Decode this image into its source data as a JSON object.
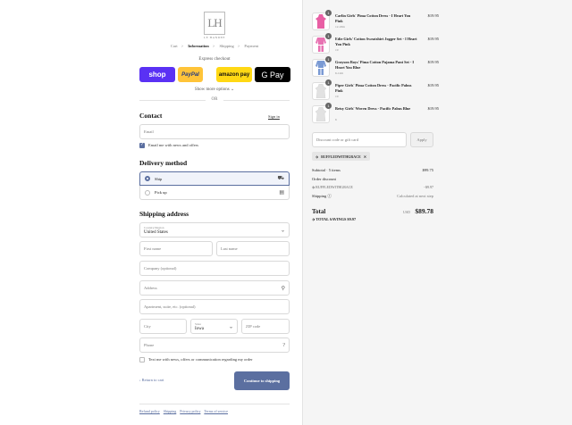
{
  "brand": {
    "logo_letters": "LH",
    "logo_text": "LE HANDEE"
  },
  "breadcrumbs": [
    {
      "label": "Cart"
    },
    {
      "label": "Information"
    },
    {
      "label": "Shipping"
    },
    {
      "label": "Payment"
    }
  ],
  "breadcrumb_separator": ">",
  "express": {
    "title": "Express checkout",
    "buttons": [
      "shop",
      "PayPal",
      "amazon pay",
      "G Pay"
    ],
    "show_more": "Show more options ⌄",
    "or": "OR"
  },
  "contact": {
    "heading": "Contact",
    "sign_in": "Sign in",
    "email_placeholder": "Email",
    "newsletter_label": "Email me with news and offers",
    "newsletter_checked": true
  },
  "delivery": {
    "heading": "Delivery method",
    "options": [
      {
        "label": "Ship",
        "selected": true,
        "icon": "truck-icon"
      },
      {
        "label": "Pick up",
        "selected": false,
        "icon": "store-icon"
      }
    ]
  },
  "shipping": {
    "heading": "Shipping address",
    "country_label": "Country/Region",
    "country_value": "United States",
    "first_name": "First name",
    "last_name": "Last name",
    "company": "Company (optional)",
    "address": "Address",
    "apartment": "Apartment, suite, etc. (optional)",
    "city": "City",
    "state_label": "State",
    "state_value": "Iowa",
    "zip": "ZIP code",
    "phone": "Phone",
    "sms_label": "Text me with news, offers or communication regarding my order",
    "sms_checked": false
  },
  "actions": {
    "return_label": "Return to cart",
    "continue_label": "Continue to shipping"
  },
  "footer": [
    "Refund policy",
    "Shipping",
    "Privacy policy",
    "Terms of service"
  ],
  "order": {
    "items": [
      {
        "name": "Carlin Girls' Pima Cotton Dress - I Heart You Pink",
        "variant": "12-18m",
        "qty": "1",
        "price": "$19.95",
        "color": "#e85fa4"
      },
      {
        "name": "Edie Girls' Cotton Sweatshirt Jogger Set - I Heart You Pink",
        "variant": "10",
        "qty": "1",
        "price": "$19.95",
        "color": "#e872b2"
      },
      {
        "name": "Grayson Boys' Pima Cotton Pajama Pant Set - I Heart You Blue",
        "variant": "6-12m",
        "qty": "1",
        "price": "$19.95",
        "color": "#7a9ad4"
      },
      {
        "name": "Piper Girls' Pima Cotton Dress - Pacific Palms Pink",
        "variant": "10",
        "qty": "1",
        "price": "$19.95",
        "color": "#f1f1f1"
      },
      {
        "name": "Betsy Girls' Woven Dress - Pacific Palms Blue",
        "variant": "6",
        "qty": "1",
        "price": "$19.95",
        "color": "#eeeeee"
      }
    ],
    "discount_placeholder": "Discount code or gift card",
    "apply_label": "Apply",
    "applied_code": "RUFFLEDWITHGRACE",
    "subtotal_label": "Subtotal · 5 items",
    "subtotal_value": "$99.75",
    "order_discount_label": "Order discount",
    "discount_code_label": "RUFFLEDWITHGRACE",
    "discount_value": "−$9.97",
    "shipping_label": "Shipping",
    "shipping_value": "Calculated at next step",
    "total_label": "Total",
    "currency": "USD",
    "total_value": "$89.78",
    "savings_label": "TOTAL SAVINGS $9.97"
  },
  "colors": {
    "accent": "#5b6fa0",
    "shop": "#5a31f4",
    "paypal": "#ffc439",
    "amazon": "#ffd814"
  }
}
